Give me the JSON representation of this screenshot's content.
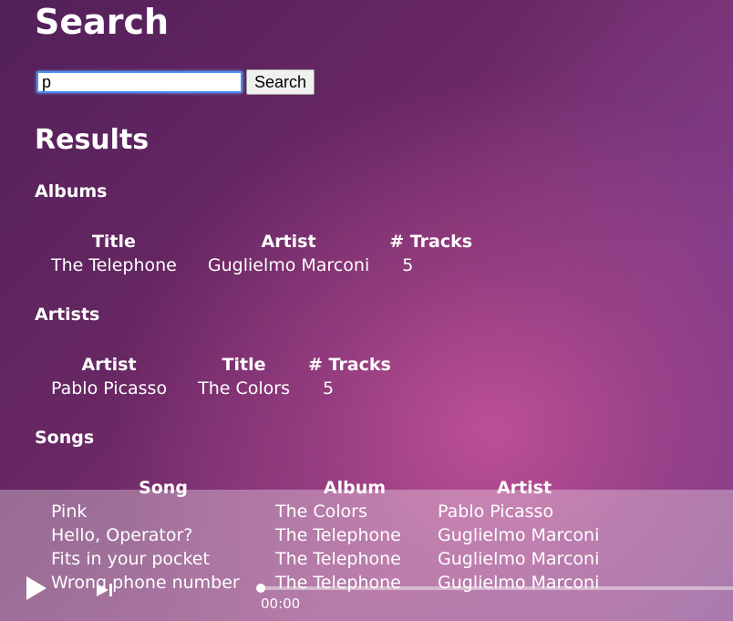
{
  "search": {
    "title": "Search",
    "input_value": "p",
    "button_label": "Search"
  },
  "results": {
    "title": "Results",
    "albums": {
      "title": "Albums",
      "headers": [
        "Title",
        "Artist",
        "# Tracks"
      ],
      "rows": [
        [
          "The Telephone",
          "Guglielmo Marconi",
          "5"
        ]
      ]
    },
    "artists": {
      "title": "Artists",
      "headers": [
        "Artist",
        "Title",
        "# Tracks"
      ],
      "rows": [
        [
          "Pablo Picasso",
          "The Colors",
          "5"
        ]
      ]
    },
    "songs": {
      "title": "Songs",
      "headers": [
        "Song",
        "Album",
        "Artist"
      ],
      "rows": [
        [
          "Pink",
          "The Colors",
          "Pablo Picasso"
        ],
        [
          "Hello, Operator?",
          "The Telephone",
          "Guglielmo Marconi"
        ],
        [
          "Fits in your pocket",
          "The Telephone",
          "Guglielmo Marconi"
        ],
        [
          "Wrong phone number",
          "The Telephone",
          "Guglielmo Marconi"
        ]
      ]
    }
  },
  "player": {
    "play_icon": "play-icon",
    "next_icon": "skip-next-icon",
    "time": "00:00",
    "progress": 0
  }
}
